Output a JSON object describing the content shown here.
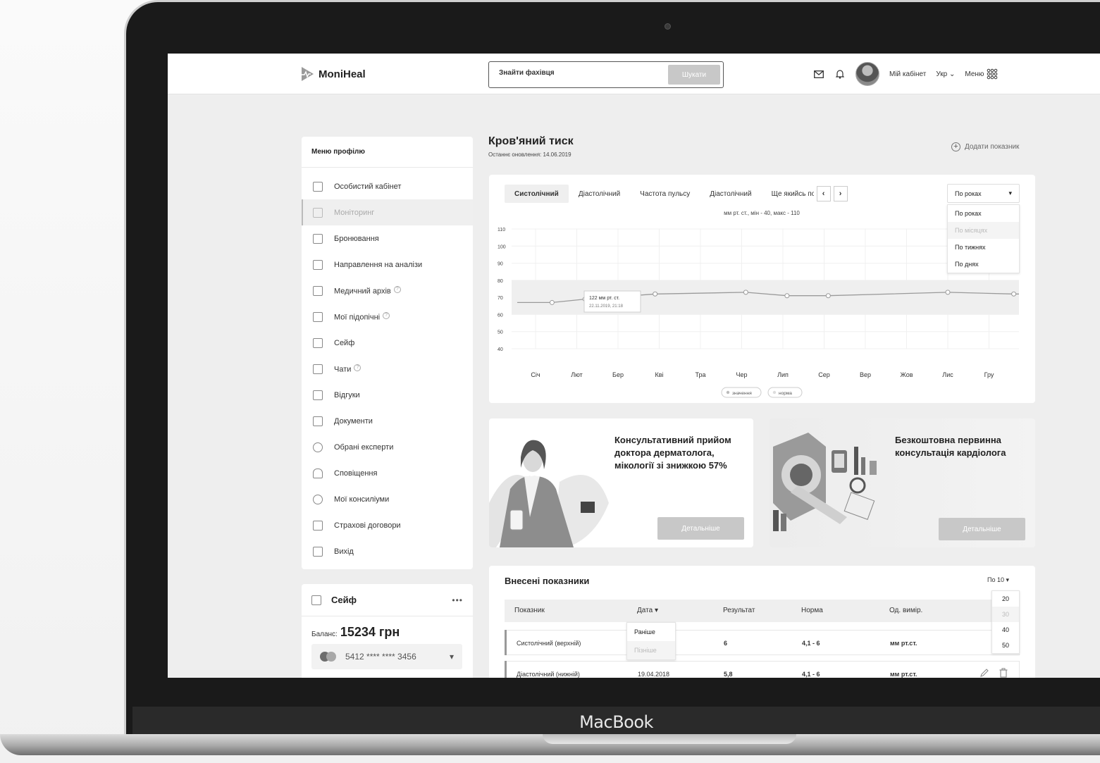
{
  "laptop": {
    "brand": "MacBook"
  },
  "header": {
    "logo": "MoniHeal",
    "search_placeholder": "Знайти фахівця",
    "search_button": "Шукати",
    "cabinet": "Мій кабінет",
    "lang": "Укр",
    "menu": "Меню"
  },
  "sidebar": {
    "title": "Меню профілю",
    "items": [
      {
        "label": "Особистий кабінет",
        "icon": "grid-icon"
      },
      {
        "label": "Моніторинг",
        "icon": "trend-icon"
      },
      {
        "label": "Бронювання",
        "icon": "calendar-icon"
      },
      {
        "label": "Направлення на аналізи",
        "icon": "list-icon"
      },
      {
        "label": "Медичний архів",
        "icon": "archive-icon"
      },
      {
        "label": "Мої підопічні",
        "icon": "people-icon"
      },
      {
        "label": "Сейф",
        "icon": "safe-icon"
      },
      {
        "label": "Чати",
        "icon": "chat-icon"
      },
      {
        "label": "Відгуки",
        "icon": "review-icon"
      },
      {
        "label": "Документи",
        "icon": "document-icon"
      },
      {
        "label": "Обрані експерти",
        "icon": "expert-icon"
      },
      {
        "label": "Сповіщення",
        "icon": "bell-icon"
      },
      {
        "label": "Мої консиліуми",
        "icon": "council-icon"
      },
      {
        "label": "Страхові договори",
        "icon": "contract-icon"
      },
      {
        "label": "Вихід",
        "icon": "logout-icon"
      }
    ]
  },
  "safe": {
    "title": "Сейф",
    "balance_label": "Баланс:",
    "balance": "15234 грн",
    "card": "5412 **** **** 3456"
  },
  "main": {
    "title": "Кров'яний тиск",
    "updated": "Останнє оновлення: 14.06.2019",
    "add": "Додати показник"
  },
  "chart": {
    "tabs": [
      "Систолічний",
      "Діастолічний",
      "Частота пульсу",
      "Діастолічний",
      "Ще якийсь показник"
    ],
    "period_selected": "По роках",
    "period_options": [
      "По роках",
      "По місяцях",
      "По тижнях",
      "По днях"
    ],
    "subtitle": "мм рт. ст., мін - 40, макс - 110",
    "tooltip_value": "122 мм рт. ст.",
    "tooltip_date": "22.11.2019, 21:18",
    "legend_value": "значення",
    "legend_norm": "норма"
  },
  "chart_data": {
    "type": "line",
    "categories": [
      "Січ",
      "Лют",
      "Бер",
      "Кві",
      "Тра",
      "Чер",
      "Лип",
      "Сер",
      "Вер",
      "Жов",
      "Лис",
      "Гру"
    ],
    "series": [
      {
        "name": "значення",
        "points": [
          [
            0.4,
            67
          ],
          [
            1.2,
            69
          ],
          [
            2.9,
            72
          ],
          [
            5.1,
            73
          ],
          [
            6.1,
            71
          ],
          [
            7.1,
            71
          ],
          [
            10.0,
            73
          ],
          [
            11.6,
            72
          ]
        ]
      }
    ],
    "norm_band": [
      60,
      80
    ],
    "y_ticks": [
      110,
      100,
      90,
      80,
      70,
      60,
      50,
      40
    ],
    "ylim": [
      40,
      110
    ]
  },
  "promos": [
    {
      "text": "Консультативний прийом доктора дерматолога, мікології зі знижкою 57%",
      "button": "Детальніше"
    },
    {
      "text": "Безкоштовна первинна консультація кардіолога",
      "button": "Детальніше"
    }
  ],
  "table": {
    "title": "Внесені показники",
    "per_page": "По 10",
    "per_page_options": [
      "20",
      "30",
      "40",
      "50"
    ],
    "headers": [
      "Показник",
      "Дата",
      "Результат",
      "Норма",
      "Од. вимір."
    ],
    "date_sort_options": [
      "Раніше",
      "Пізніше"
    ],
    "rows": [
      {
        "name": "Систолічний (верхній)",
        "date": "",
        "result": "6",
        "norm": "4,1 - 6",
        "unit": "мм рт.ст."
      },
      {
        "name": "Діастолічний (нижній)",
        "date": "19.04.2018",
        "result": "5,8",
        "norm": "4,1 - 6",
        "unit": "мм рт.ст."
      }
    ]
  }
}
